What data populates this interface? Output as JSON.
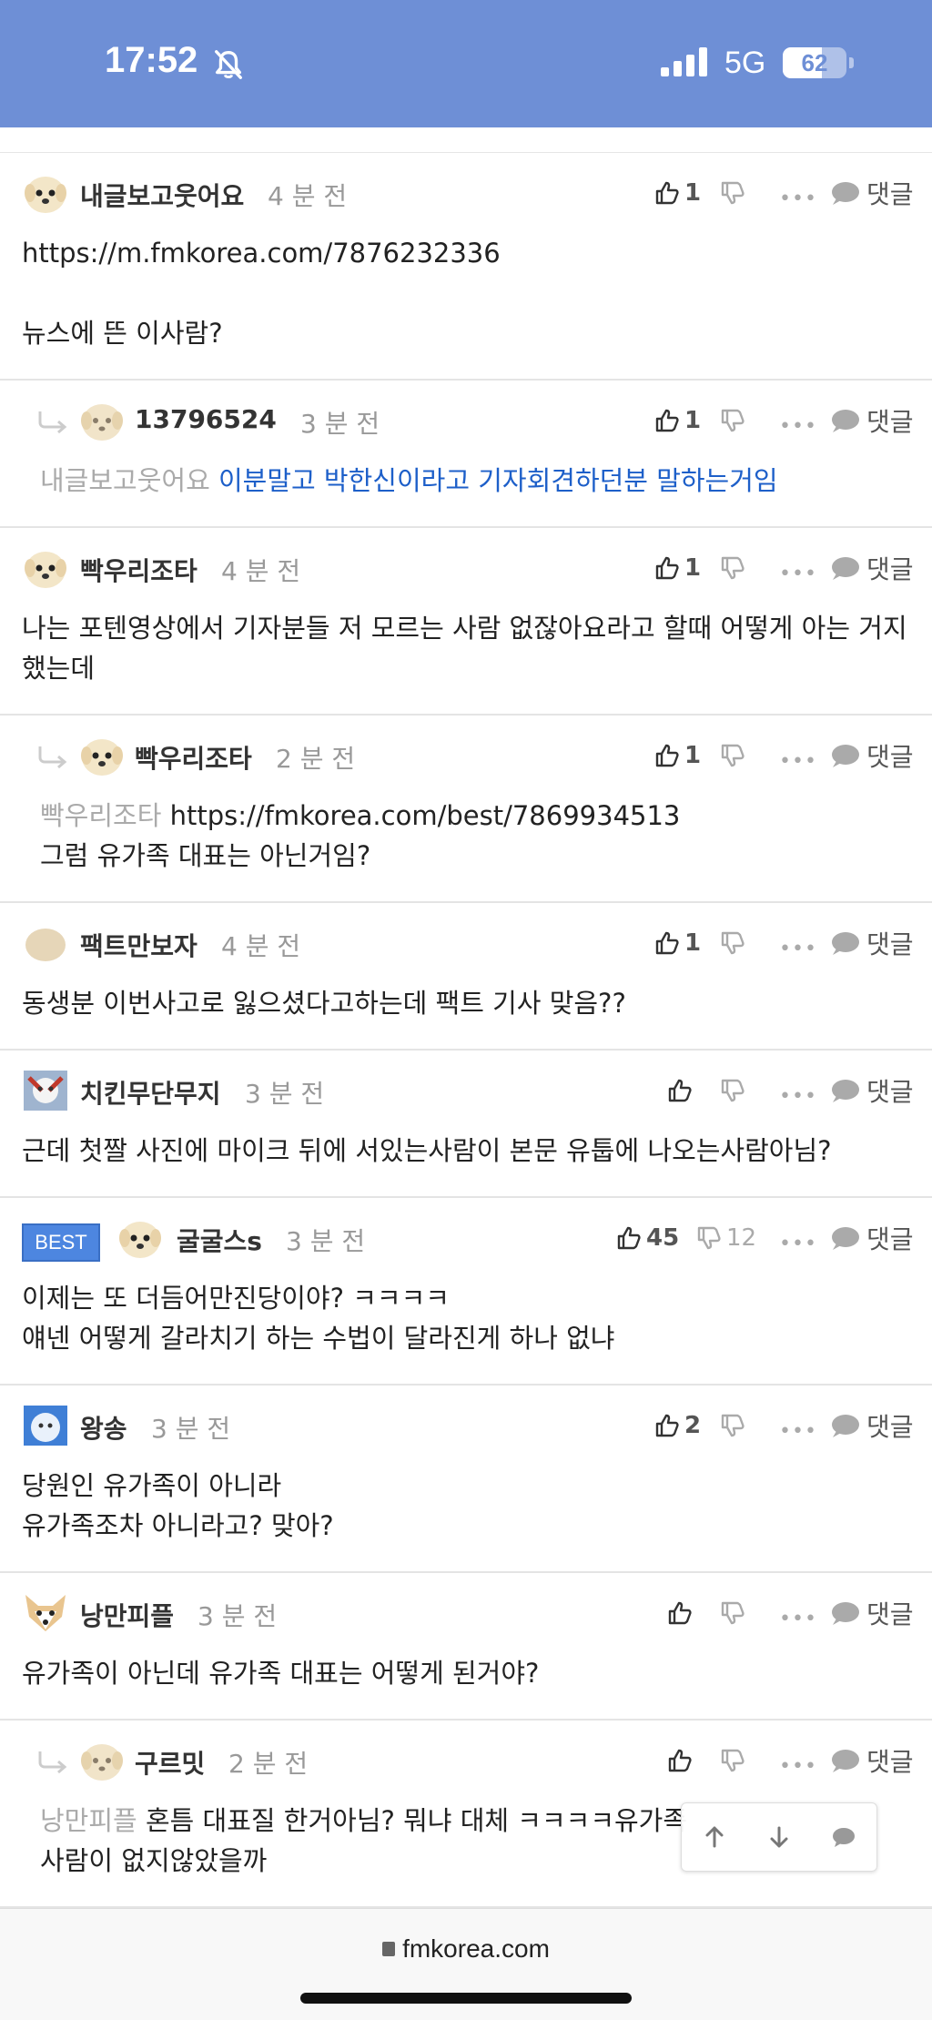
{
  "status_bar": {
    "time": "17:52",
    "network": "5G",
    "battery": "62",
    "battery_level": 0.62
  },
  "comments": [
    {
      "nick": "내글보고웃어요",
      "time": "4 분 전",
      "likes": "1",
      "dislikes": "",
      "reply_label": "댓글",
      "mention": "",
      "text": "https://m.fmkorea.com/7876232336",
      "text2": "뉴스에 뜬 이사람?",
      "is_reply": false,
      "best": false,
      "avatar": "dog"
    },
    {
      "nick": "13796524",
      "time": "3 분 전",
      "likes": "1",
      "dislikes": "",
      "reply_label": "댓글",
      "mention": "내글보고웃어요",
      "text": "이분말고 박한신이라고 기자회견하던분 말하는거임",
      "text2": "",
      "is_reply": true,
      "best": false,
      "avatar": "dog-light"
    },
    {
      "nick": "빡우리조타",
      "time": "4 분 전",
      "likes": "1",
      "dislikes": "",
      "reply_label": "댓글",
      "mention": "",
      "text": "나는 포텐영상에서 기자분들 저 모르는 사람 없잖아요라고 할때 어떻게 아는 거지 했는데",
      "text2": "",
      "is_reply": false,
      "best": false,
      "avatar": "dog"
    },
    {
      "nick": "빡우리조타",
      "time": "2 분 전",
      "likes": "1",
      "dislikes": "",
      "reply_label": "댓글",
      "mention": "빡우리조타",
      "text": "https://fmkorea.com/best/7869934513",
      "text2": "그럼 유가족 대표는 아닌거임?",
      "is_reply": true,
      "best": false,
      "avatar": "dog"
    },
    {
      "nick": "팩트만보자",
      "time": "4 분 전",
      "likes": "1",
      "dislikes": "",
      "reply_label": "댓글",
      "mention": "",
      "text": "동생분 이번사고로 잃으셨다고하는데 팩트 기사 맞음??",
      "text2": "",
      "is_reply": false,
      "best": false,
      "avatar": "blob"
    },
    {
      "nick": "치킨무단무지",
      "time": "3 분 전",
      "likes": "",
      "dislikes": "",
      "reply_label": "댓글",
      "mention": "",
      "text": "근데 첫짤 사진에 마이크 뒤에 서있는사람이 본문 유툽에 나오는사람아님?",
      "text2": "",
      "is_reply": false,
      "best": false,
      "avatar": "photo-red"
    },
    {
      "nick": "굴굴스s",
      "time": "3 분 전",
      "likes": "45",
      "dislikes": "12",
      "reply_label": "댓글",
      "mention": "",
      "text": "이제는 또 더듬어만진당이야? ㅋㅋㅋㅋ",
      "text2": "얘넨 어떻게 갈라치기 하는 수법이 달라진게 하나 없냐",
      "is_reply": false,
      "best": true,
      "best_label": "BEST",
      "avatar": "dog"
    },
    {
      "nick": "왕송",
      "time": "3 분 전",
      "likes": "2",
      "dislikes": "",
      "reply_label": "댓글",
      "mention": "",
      "text": "당원인 유가족이 아니라",
      "text2": "유가족조차 아니라고? 맞아?",
      "is_reply": false,
      "best": false,
      "avatar": "photo-blue"
    },
    {
      "nick": "낭만피플",
      "time": "3 분 전",
      "likes": "",
      "dislikes": "",
      "reply_label": "댓글",
      "mention": "",
      "text": "유가족이 아닌데 유가족 대표는 어떻게 된거야?",
      "text2": "",
      "is_reply": false,
      "best": false,
      "avatar": "fox"
    },
    {
      "nick": "구르밋",
      "time": "2 분 전",
      "likes": "",
      "dislikes": "",
      "reply_label": "댓글",
      "mention": "낭만피플",
      "text": "혼틈 대표질 한거아님? 뭐냐 대체 ㅋㅋㅋㅋ유가족",
      "text2": "사람이 없지않았을까",
      "is_reply": true,
      "best": false,
      "avatar": "dog-light"
    }
  ],
  "bottom_bar": {
    "url": "fmkorea.com"
  }
}
